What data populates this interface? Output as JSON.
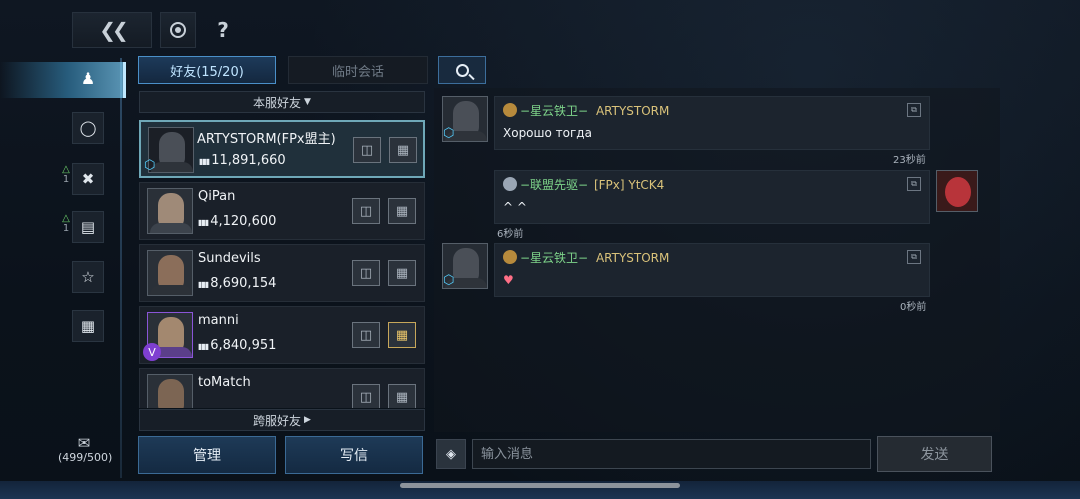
{
  "top": {
    "back_icon": "double-chevron-left-icon",
    "refresh_icon": "refresh-icon",
    "help_label": "?"
  },
  "nav": {
    "items": [
      {
        "icon": "friends-person-icon"
      },
      {
        "icon": "globe-icon"
      },
      {
        "icon": "crossed-swords-icon",
        "badge": "1"
      },
      {
        "icon": "document-icon",
        "badge": "1"
      },
      {
        "icon": "star-icon"
      },
      {
        "icon": "gift-icon"
      }
    ],
    "mail_count": "(499/500)"
  },
  "tabs": {
    "friends": "好友(15/20)",
    "temp_chat": "临时会话"
  },
  "sections": {
    "local": "本服好友",
    "cross": "跨服好友"
  },
  "friends": [
    {
      "name": "ARTYSTORM(FPx盟主)",
      "power": "11,891,660",
      "badge": "cube"
    },
    {
      "name": "QiPan",
      "power": "4,120,600"
    },
    {
      "name": "Sundevils",
      "power": "8,690,154"
    },
    {
      "name": "manni",
      "power": "6,840,951",
      "badge": "V"
    },
    {
      "name": "toMatch",
      "power": ""
    }
  ],
  "buttons": {
    "manage": "管理",
    "write": "写信",
    "send": "发送"
  },
  "chat": {
    "messages": [
      {
        "alliance": "−星云铁卫−",
        "name": "ARTYSTORM",
        "text": "Хорошо тогда",
        "time": "23秒前"
      },
      {
        "alliance": "−联盟先驱−",
        "name": "[FPx] YtCK4",
        "text": "^ ^",
        "time": "6秒前"
      },
      {
        "alliance": "−星云铁卫−",
        "name": "ARTYSTORM",
        "text": "♥",
        "time": "0秒前"
      }
    ],
    "input_placeholder": "输入消息"
  },
  "colors": {
    "accent": "#4a8fc8",
    "alliance_green": "#7ed48a",
    "name_gold": "#d9c27a"
  }
}
